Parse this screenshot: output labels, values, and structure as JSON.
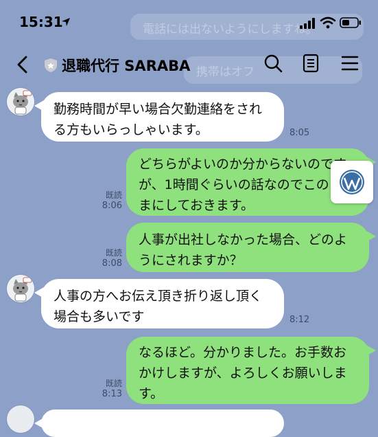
{
  "status_bar": {
    "time": "15:31"
  },
  "header": {
    "title": "退職代行 SARABA"
  },
  "background_ghost": {
    "line1": "電話には出ないようにしますね。",
    "line2": "携帯はオフ"
  },
  "messages": [
    {
      "side": "left",
      "lines": [
        "勤務時間が早い場合欠勤連絡をされ",
        "る方もいらっしゃいます。"
      ],
      "time": "8:05"
    },
    {
      "side": "right",
      "lines": [
        "どちらがよいのか分からないのです",
        "が、1時間ぐらいの話なのでこのま",
        "まにしておきます。"
      ],
      "read": "既読",
      "time": "8:06"
    },
    {
      "side": "right",
      "lines": [
        "人事が出社しなかった場合、どのよ",
        "うにされますか？"
      ],
      "read": "既読",
      "time": "8:08"
    },
    {
      "side": "left",
      "lines": [
        "人事の方へお伝え頂き折り返し頂く",
        "場合も多いです"
      ],
      "time": "8:12"
    },
    {
      "side": "right",
      "lines": [
        "なるほど。分かりました。お手数お",
        "かけしますが、よろしくお願いしま",
        "す。"
      ],
      "read": "既読",
      "time": "8:13"
    }
  ],
  "colors": {
    "chat_bg": "#8da0c8",
    "sent_bubble": "#8ee17c",
    "received_bubble": "#ffffff"
  },
  "icons": [
    "location-arrow-icon",
    "signal-icon",
    "wifi-icon",
    "battery-icon",
    "back-chevron-icon",
    "shield-icon",
    "search-icon",
    "notes-icon",
    "menu-icon",
    "cat-avatar-icon",
    "wordpress-icon"
  ]
}
